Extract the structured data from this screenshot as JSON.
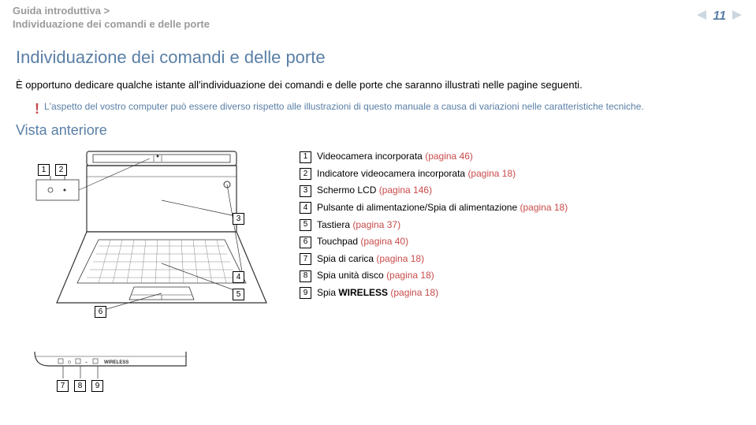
{
  "breadcrumb": {
    "section": "Guida introduttiva >",
    "page": "Individuazione dei comandi e delle porte"
  },
  "page_number": "11",
  "title": "Individuazione dei comandi e delle porte",
  "intro": "È opportuno dedicare qualche istante all'individuazione dei comandi e delle porte che saranno illustrati nelle pagine seguenti.",
  "note": "L'aspetto del vostro computer può essere diverso rispetto alle illustrazioni di questo manuale a causa di variazioni nelle caratteristiche tecniche.",
  "subtitle": "Vista anteriore",
  "legend": [
    {
      "n": "1",
      "label": "Videocamera incorporata ",
      "link": "(pagina 46)"
    },
    {
      "n": "2",
      "label": "Indicatore videocamera incorporata ",
      "link": "(pagina 18)"
    },
    {
      "n": "3",
      "label": "Schermo LCD ",
      "link": "(pagina 146)"
    },
    {
      "n": "4",
      "label": "Pulsante di alimentazione/Spia di alimentazione ",
      "link": "(pagina 18)"
    },
    {
      "n": "5",
      "label": "Tastiera ",
      "link": "(pagina 37)"
    },
    {
      "n": "6",
      "label": "Touchpad ",
      "link": "(pagina 40)"
    },
    {
      "n": "7",
      "label": "Spia di carica ",
      "link": "(pagina 18)"
    },
    {
      "n": "8",
      "label": "Spia unità disco ",
      "link": "(pagina 18)"
    },
    {
      "n": "9",
      "pre": "Spia ",
      "bold": "WIRELESS",
      "post": " ",
      "link": "(pagina 18)"
    }
  ],
  "diagram": {
    "callouts_top": [
      "1",
      "2",
      "3",
      "4",
      "5",
      "6"
    ],
    "callouts_bottom": [
      "7",
      "8",
      "9"
    ],
    "port_label": "WIRELESS"
  }
}
